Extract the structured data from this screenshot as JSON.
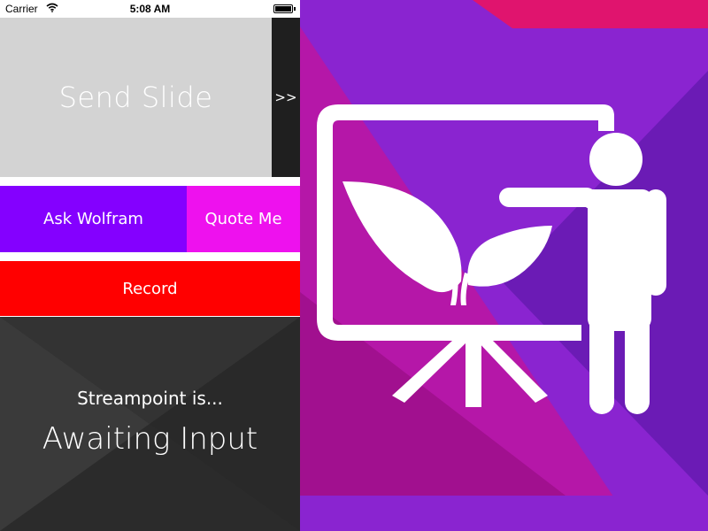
{
  "status_bar": {
    "carrier": "Carrier",
    "time": "5:08 AM"
  },
  "controls": {
    "send_slide": "Send Slide",
    "next_slide": ">>",
    "ask_wolfram": "Ask Wolfram",
    "quote_me": "Quote Me",
    "record": "Record"
  },
  "status_panel": {
    "caption": "Streampoint is...",
    "state": "Awaiting Input"
  },
  "icons": {
    "wifi": "wifi-icon",
    "battery": "battery-icon",
    "presentation": "presenter-at-screen-icon"
  },
  "colors": {
    "send_slide_bg": "#d3d3d3",
    "next_bg": "#1f1f1f",
    "ask_wolfram_bg": "#8400ff",
    "quote_me_bg": "#ee11ee",
    "record_bg": "#ff0000",
    "status_panel_bg": "#2e2e2e",
    "art_primary": "#8a24d0",
    "art_magenta": "#b517a8",
    "art_deep": "#6b1bb5",
    "art_pink": "#e0146e"
  }
}
